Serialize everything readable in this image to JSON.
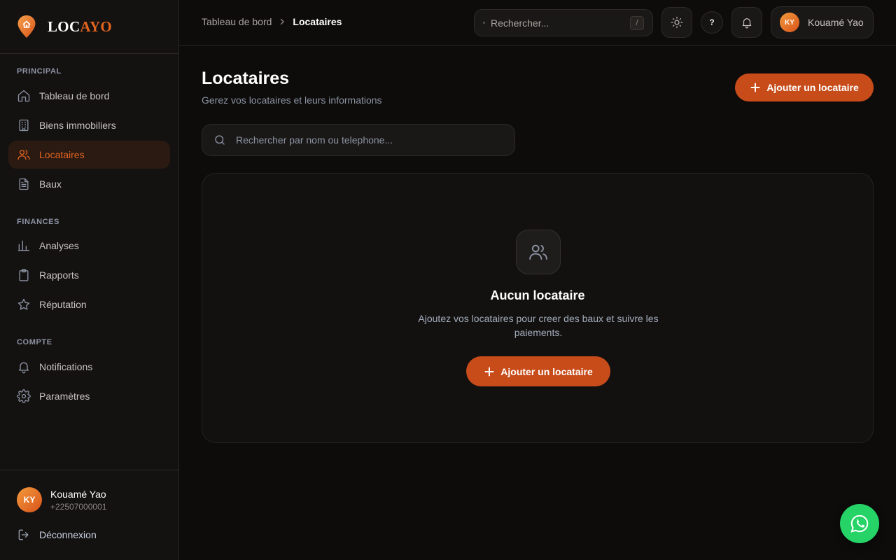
{
  "brand": {
    "name_part1": "LOC",
    "name_part2": "AYO",
    "accent": "#e2641f"
  },
  "sidebar": {
    "sections": [
      {
        "title": "PRINCIPAL"
      },
      {
        "title": "FINANCES"
      },
      {
        "title": "COMPTE"
      }
    ],
    "items": [
      {
        "label": "Tableau de bord",
        "icon": "home-icon"
      },
      {
        "label": "Biens immobiliers",
        "icon": "building-icon"
      },
      {
        "label": "Locataires",
        "icon": "users-icon",
        "active": true
      },
      {
        "label": "Baux",
        "icon": "document-icon"
      },
      {
        "label": "Analyses",
        "icon": "bar-chart-icon"
      },
      {
        "label": "Rapports",
        "icon": "clipboard-icon"
      },
      {
        "label": "Réputation",
        "icon": "star-icon"
      },
      {
        "label": "Notifications",
        "icon": "bell-icon"
      },
      {
        "label": "Paramètres",
        "icon": "gear-icon"
      }
    ],
    "user": {
      "initials": "KY",
      "name": "Kouamé Yao",
      "phone": "+22507000001"
    },
    "logout_label": "Déconnexion"
  },
  "topbar": {
    "breadcrumb": {
      "parent": "Tableau de bord",
      "current": "Locataires"
    },
    "search_placeholder": "Rechercher...",
    "search_shortcut": "/",
    "help_label": "?",
    "user": {
      "initials": "KY",
      "name": "Kouamé Yao"
    }
  },
  "main": {
    "title": "Locataires",
    "subtitle": "Gerez vos locataires et leurs informations",
    "add_button_label": "Ajouter un locataire",
    "search_placeholder": "Rechercher par nom ou telephone...",
    "empty_state": {
      "title": "Aucun locataire",
      "description": "Ajoutez vos locataires pour creer des baux et suivre les paiements.",
      "button_label": "Ajouter un locataire"
    }
  },
  "colors": {
    "primary_button": "#c84c1a",
    "whatsapp": "#25d366"
  }
}
